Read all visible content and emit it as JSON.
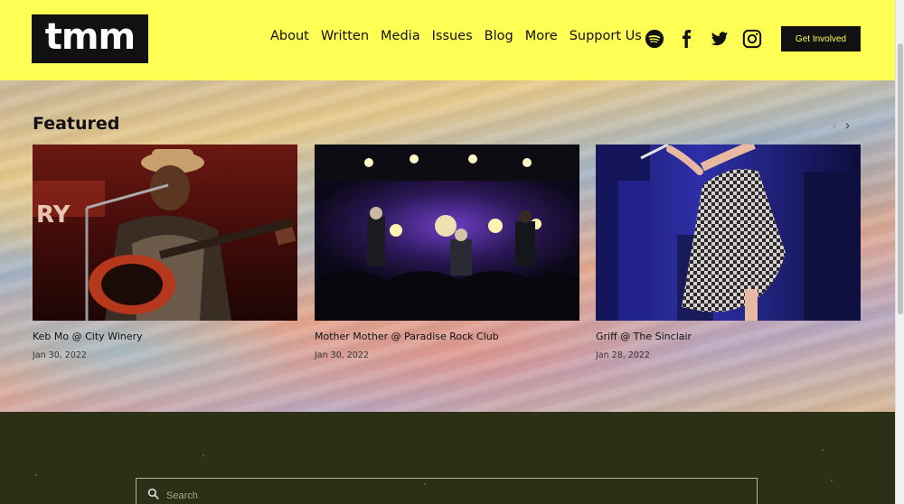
{
  "brand": {
    "logo_text": "tmm",
    "accent": "#fffe55"
  },
  "nav": {
    "items": [
      {
        "label": "About"
      },
      {
        "label": "Written"
      },
      {
        "label": "Media"
      },
      {
        "label": "Issues"
      },
      {
        "label": "Blog"
      },
      {
        "label": "More"
      },
      {
        "label": "Support Us"
      }
    ],
    "social": [
      "spotify-icon",
      "facebook-icon",
      "twitter-icon",
      "instagram-icon"
    ],
    "cta_label": "Get Involved"
  },
  "featured": {
    "heading": "Featured",
    "cards": [
      {
        "title": "Keb Mo @ City Winery",
        "date": "Jan 30, 2022",
        "image": "concert-photo-guitarist"
      },
      {
        "title": "Mother Mother @ Paradise Rock Club",
        "date": "Jan 30, 2022",
        "image": "concert-photo-stage"
      },
      {
        "title": "Griff @ The Sinclair",
        "date": "Jan 28, 2022",
        "image": "concert-photo-singer"
      }
    ]
  },
  "search": {
    "placeholder": "Search"
  }
}
